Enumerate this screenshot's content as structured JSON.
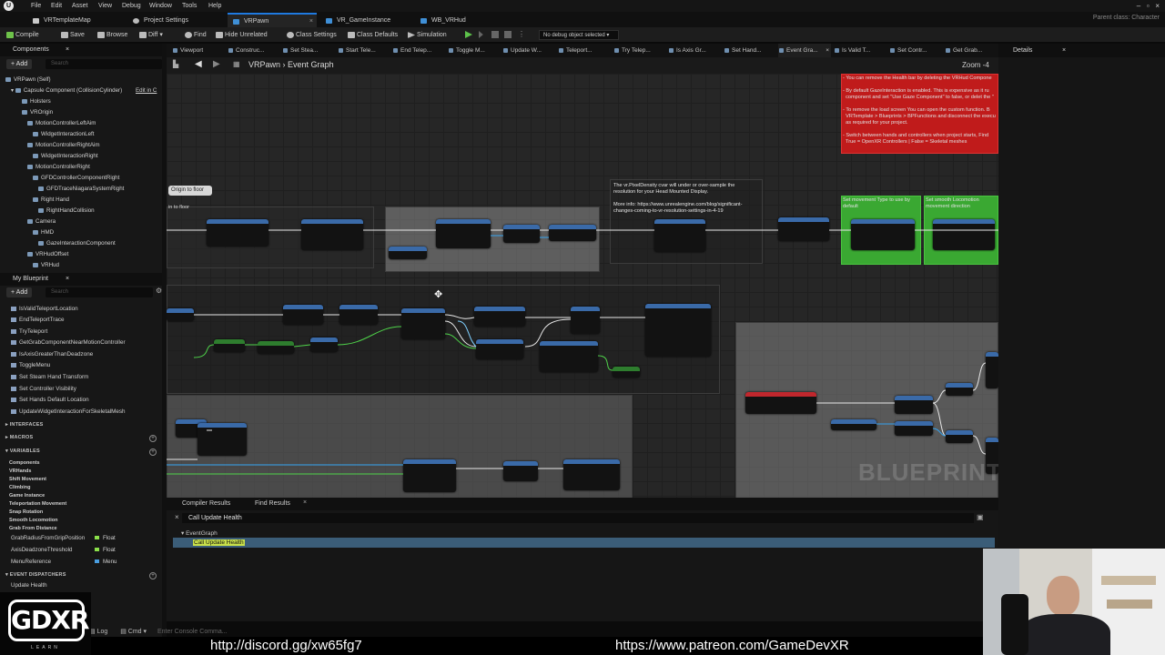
{
  "menu": [
    "File",
    "Edit",
    "Asset",
    "View",
    "Debug",
    "Window",
    "Tools",
    "Help"
  ],
  "tabs": [
    {
      "label": "VRTemplateMap",
      "active": false
    },
    {
      "label": "Project Settings",
      "active": false
    },
    {
      "label": "VRPawn",
      "active": true
    },
    {
      "label": "VR_GameInstance",
      "active": false
    },
    {
      "label": "WB_VRHud",
      "active": false
    }
  ],
  "parent_class": "Parent class: Character",
  "toolbar": {
    "compile": "Compile",
    "save": "Save",
    "browse": "Browse",
    "diff": "Diff",
    "find": "Find",
    "hide_unrelated": "Hide Unrelated",
    "class_settings": "Class Settings",
    "class_defaults": "Class Defaults",
    "simulation": "Simulation",
    "debug_object": "No debug object selected"
  },
  "components": {
    "title": "Components",
    "add": "+ Add",
    "search_placeholder": "Search",
    "root": "VRPawn (Self)",
    "items": [
      {
        "label": "Capsule Component (CollisionCylinder)",
        "extra": "Edit in C"
      },
      {
        "label": "Holsters"
      },
      {
        "label": "VROrigin"
      },
      {
        "label": "MotionControllerLeftAim"
      },
      {
        "label": "WidgetInteractionLeft"
      },
      {
        "label": "MotionControllerRightAim"
      },
      {
        "label": "WidgetInteractionRight"
      },
      {
        "label": "MotionControllerRight"
      },
      {
        "label": "GFDControllerComponentRight"
      },
      {
        "label": "GFDTraceNiagaraSystemRight"
      },
      {
        "label": "Right Hand"
      },
      {
        "label": "RightHandCollision"
      },
      {
        "label": "Camera"
      },
      {
        "label": "HMD"
      },
      {
        "label": "GazeInteractionComponent"
      },
      {
        "label": "VRHudOffset"
      },
      {
        "label": "VRHud"
      }
    ]
  },
  "my_blueprint": {
    "title": "My Blueprint",
    "add": "+ Add",
    "search_placeholder": "Search",
    "functions": [
      "IsValidTeleportLocation",
      "EndTeleportTrace",
      "TryTeleport",
      "GetGrabComponentNearMotionController",
      "IsAxisGreaterThanDeadzone",
      "ToggleMenu",
      "Set Steam Hand Transform",
      "Set Controller Visibility",
      "Set Hands Default Location",
      "UpdateWidgetInteractionForSkeletalMesh"
    ],
    "interfaces": "INTERFACES",
    "macros": "MACROS",
    "variables": "VARIABLES",
    "var_categories": [
      "Components",
      "VRHands",
      "Shift Movement",
      "Climbing",
      "Game Instance",
      "Teleportation Movement",
      "Snap Rotation",
      "Smooth Locomotion",
      "Grab From Distance"
    ],
    "vars": [
      {
        "name": "GrabRadiusFromGripPosition",
        "type": "Float",
        "color": "#8be04a"
      },
      {
        "name": "AxisDeadzoneThreshold",
        "type": "Float",
        "color": "#8be04a"
      },
      {
        "name": "MenuReference",
        "type": "Menu",
        "color": "#4a9ee0"
      }
    ],
    "event_dispatchers": "EVENT DISPATCHERS",
    "dispatchers": [
      "Update Health"
    ]
  },
  "graph_tabs": [
    "Viewport",
    "Construc...",
    "Set Stea...",
    "Start Tele...",
    "End Telep...",
    "Toggle M...",
    "Update W...",
    "Teleport...",
    "Try Telep...",
    "Is Axis Gr...",
    "Set Hand...",
    "Event Gra...",
    "Is Valid T...",
    "Set Contr...",
    "Get Grab..."
  ],
  "breadcrumb": {
    "root": "VRPawn",
    "sep": "›",
    "current": "Event Graph"
  },
  "zoom": "Zoom -4",
  "details": {
    "title": "Details"
  },
  "graph": {
    "red_note": "- You can remove the Health bar by deleting the VRHud Compone\n\n- By default GazeInteraction is enabled. This is expensive as it ru\n  component and set \"Use Gaze Component\" to false, or delet the \"\n\n- To remove the load screen You can open the custom function. B\n  VRTemplate > Blueprints > BPFunctions and disconnect the execu\n  as required for your project.\n\n- Switch between hands and controllers when project starts, Find\n  True = OpenXR Controllers | False = Skeletal meshes",
    "pixel_note": "The vr.PixelDensity cvar will under or over-sample the\nresolution for your Head Mounted Display.\n\nMore info: https://www.unrealengine.com/blog/significant-\nchanges-coming-to-vr-resolution-settings-in-4-19",
    "origin_label": "Origin to floor",
    "origin_label2": "in to floor",
    "green1": "Set movement Type to use by\ndefault",
    "green2": "Set smooth Locomotion\nmovement direction",
    "watermark": "BLUEPRINT"
  },
  "bottom": {
    "tab1": "Compiler Results",
    "tab2": "Find Results",
    "search": "Call Update Health",
    "group": "EventGraph",
    "hit": "Call Update Health",
    "log": "Log",
    "cmd": "Cmd",
    "console_placeholder": "Enter Console Comma..."
  },
  "overlay": {
    "discord": "http://discord.gg/xw65fg7",
    "patreon": "https://www.patreon.com/GameDevXR",
    "logo": "GDXR",
    "logo_sub": "LEARN"
  }
}
